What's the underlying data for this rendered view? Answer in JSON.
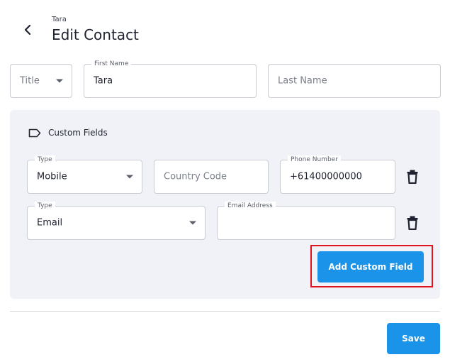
{
  "header": {
    "subtitle": "Tara",
    "title": "Edit Contact"
  },
  "name_row": {
    "title_select": {
      "placeholder": "Title"
    },
    "first_name": {
      "label": "First Name",
      "value": "Tara"
    },
    "last_name": {
      "placeholder": "Last Name"
    }
  },
  "custom_fields": {
    "section_label": "Custom Fields",
    "phone_row": {
      "type_label": "Type",
      "type_value": "Mobile",
      "country_code_placeholder": "Country Code",
      "phone_label": "Phone Number",
      "phone_value": "+61400000000"
    },
    "email_row": {
      "type_label": "Type",
      "type_value": "Email",
      "email_label": "Email Address",
      "email_value": ""
    },
    "add_button_label": "Add Custom Field"
  },
  "footer": {
    "save_label": "Save"
  },
  "colors": {
    "primary": "#1a93e8",
    "panel_bg": "#f1f2f7",
    "highlight": "#e0141f"
  }
}
